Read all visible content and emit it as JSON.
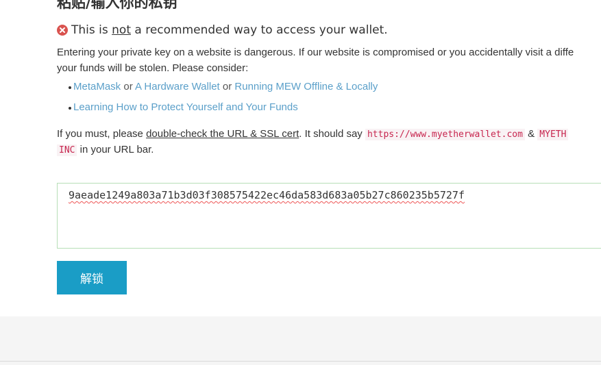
{
  "title": "粘贴/输入你的私钥",
  "warning": {
    "icon": "error-circle-icon",
    "prefix": "This is ",
    "emphasis": "not",
    "suffix": " a recommended way to access your wallet."
  },
  "paragraph1": {
    "line1": "Entering your private key on a website is dangerous. If our website is compromised or you accidentally visit a diffe",
    "line2": "your funds will be stolen. Please consider:"
  },
  "list": {
    "item1": {
      "link1": "MetaMask",
      "sep1": " or ",
      "link2": "A Hardware Wallet",
      "sep2": " or ",
      "link3": "Running MEW Offline & Locally"
    },
    "item2": {
      "link": "Learning How to Protect Yourself and Your Funds"
    }
  },
  "paragraph2": {
    "prefix": "If you must, please ",
    "underlined": "double-check the URL & SSL cert",
    "middle": ". It should say ",
    "url_code": "https://www.myetherwallet.com",
    "amp": " & ",
    "org_code_part1": "MYETH",
    "org_code_part2": "INC",
    "suffix": " in your URL bar."
  },
  "private_key_input": {
    "value": "9aeade1249a803a71b3d03f308575422ec46da583d683a05b27c860235b5727f"
  },
  "unlock_button": {
    "label": "解锁"
  },
  "colors": {
    "link": "#5a9fc9",
    "button": "#1a9dc6",
    "code_text": "#c7254e",
    "warning_icon": "#d9534f",
    "input_border": "#b7dfb7"
  }
}
